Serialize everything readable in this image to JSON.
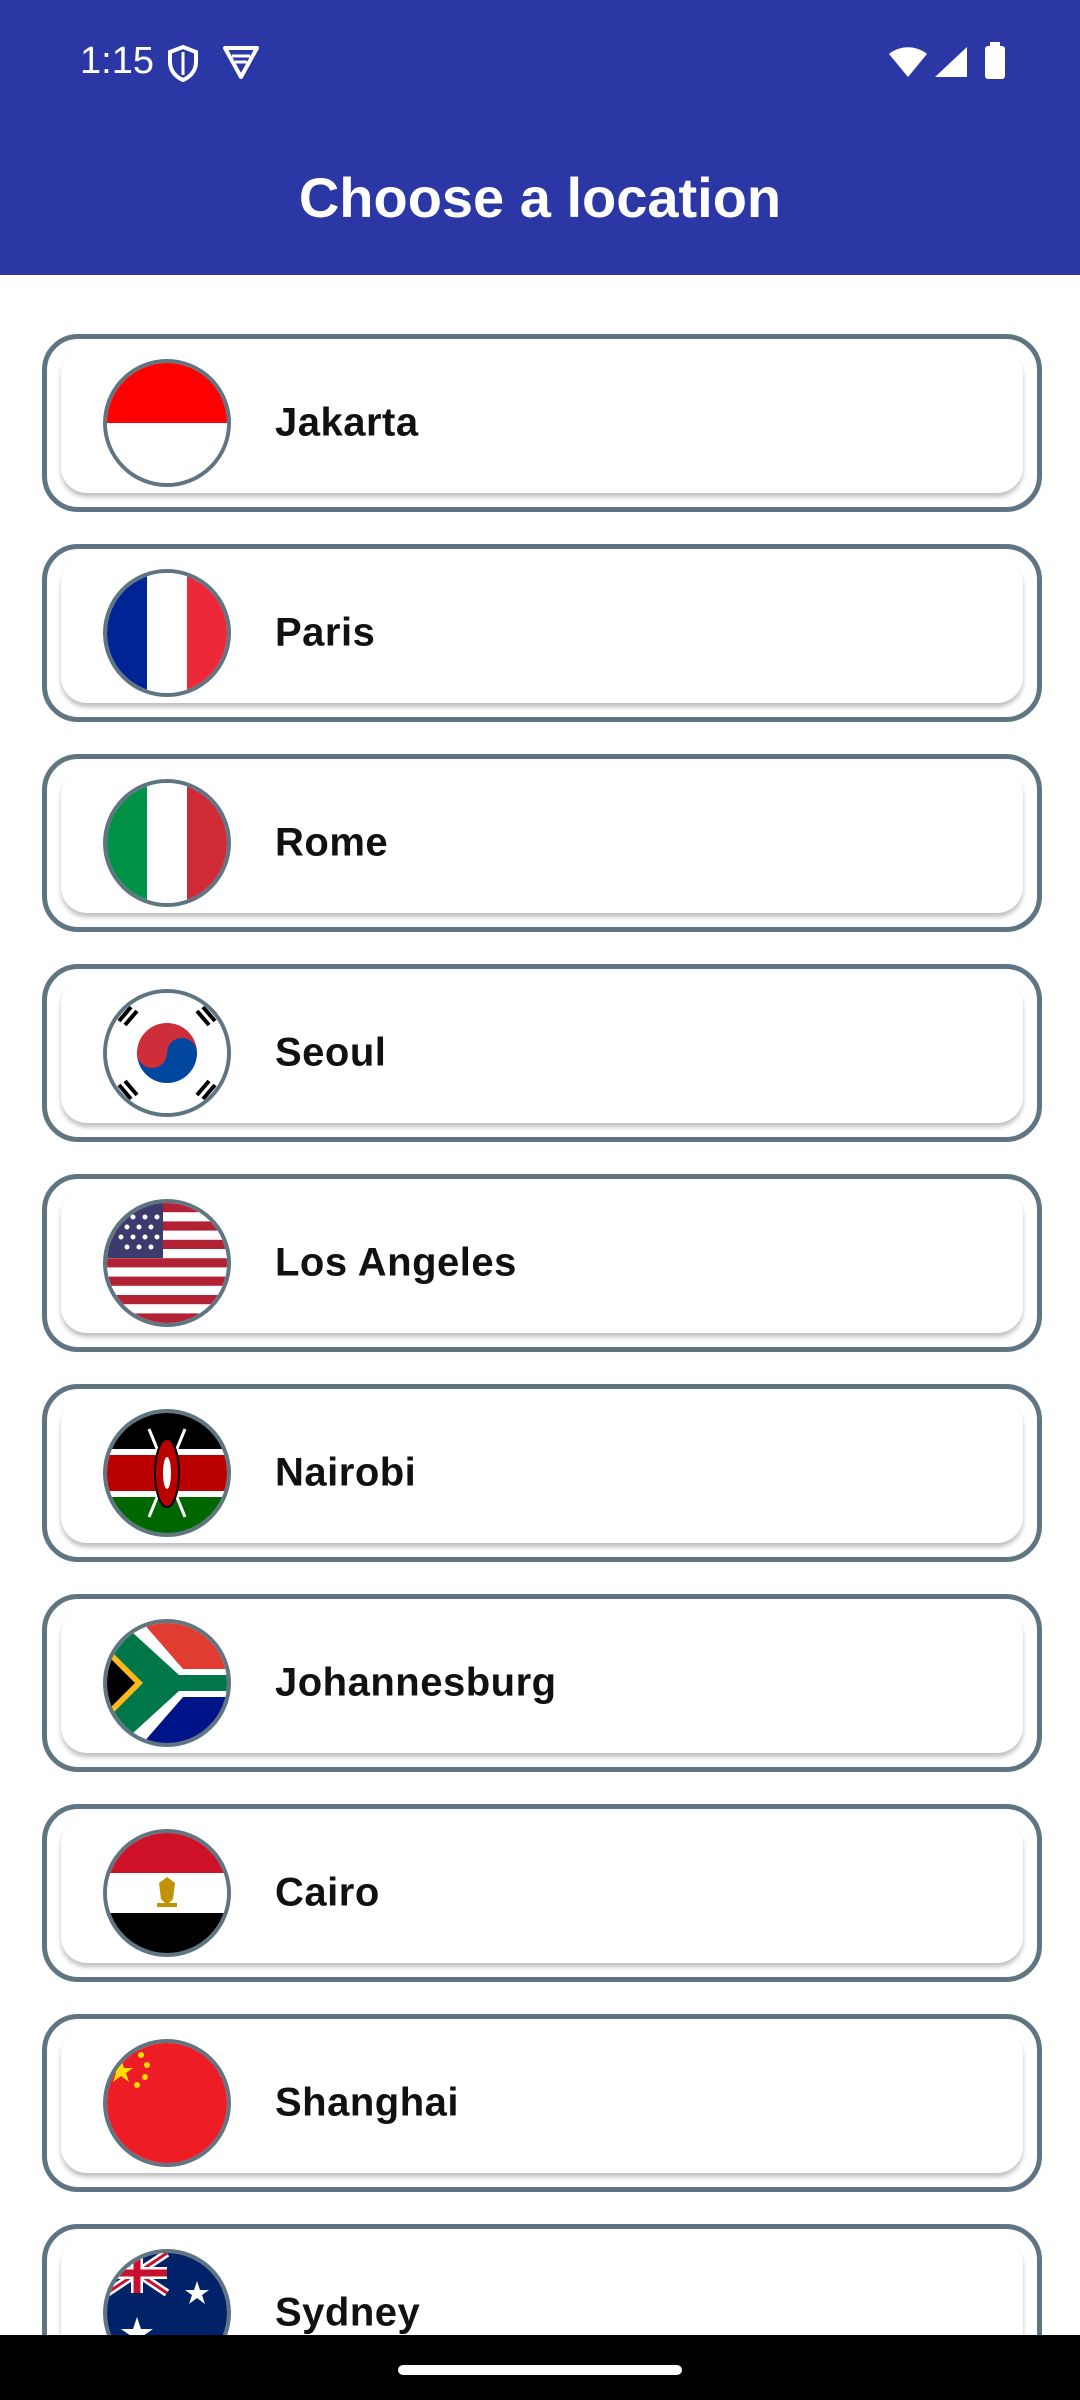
{
  "status_bar": {
    "time": "1:15"
  },
  "header": {
    "title": "Choose a location",
    "background": "#2c37a6"
  },
  "locations": [
    {
      "city": "Jakarta",
      "flag": "indonesia-flag"
    },
    {
      "city": "Paris",
      "flag": "france-flag"
    },
    {
      "city": "Rome",
      "flag": "italy-flag"
    },
    {
      "city": "Seoul",
      "flag": "south-korea-flag"
    },
    {
      "city": "Los Angeles",
      "flag": "usa-flag"
    },
    {
      "city": "Nairobi",
      "flag": "kenya-flag"
    },
    {
      "city": "Johannesburg",
      "flag": "south-africa-flag"
    },
    {
      "city": "Cairo",
      "flag": "egypt-flag"
    },
    {
      "city": "Shanghai",
      "flag": "china-flag"
    },
    {
      "city": "Sydney",
      "flag": "australia-flag"
    }
  ],
  "colors": {
    "card_border": "#5f7581",
    "text": "#111111"
  }
}
